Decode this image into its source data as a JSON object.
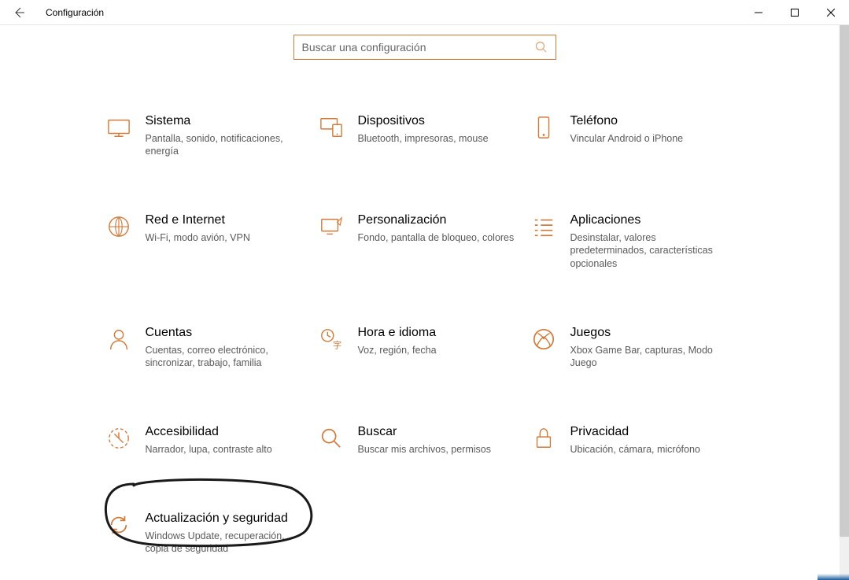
{
  "window": {
    "title": "Configuración"
  },
  "search": {
    "placeholder": "Buscar una configuración"
  },
  "tiles": {
    "system": {
      "title": "Sistema",
      "desc": "Pantalla, sonido, notificaciones, energía"
    },
    "devices": {
      "title": "Dispositivos",
      "desc": "Bluetooth, impresoras, mouse"
    },
    "phone": {
      "title": "Teléfono",
      "desc": "Vincular Android o iPhone"
    },
    "network": {
      "title": "Red e Internet",
      "desc": "Wi-Fi, modo avión, VPN"
    },
    "personalization": {
      "title": "Personalización",
      "desc": "Fondo, pantalla de bloqueo, colores"
    },
    "apps": {
      "title": "Aplicaciones",
      "desc": "Desinstalar, valores predeterminados, características opcionales"
    },
    "accounts": {
      "title": "Cuentas",
      "desc": "Cuentas, correo electrónico, sincronizar, trabajo, familia"
    },
    "time": {
      "title": "Hora e idioma",
      "desc": "Voz, región, fecha"
    },
    "gaming": {
      "title": "Juegos",
      "desc": "Xbox Game Bar, capturas, Modo Juego"
    },
    "ease": {
      "title": "Accesibilidad",
      "desc": "Narrador, lupa, contraste alto"
    },
    "searchcat": {
      "title": "Buscar",
      "desc": "Buscar mis archivos, permisos"
    },
    "privacy": {
      "title": "Privacidad",
      "desc": "Ubicación, cámara, micrófono"
    },
    "update": {
      "title": "Actualización y seguridad",
      "desc": "Windows Update, recuperación, copia de seguridad"
    }
  },
  "colors": {
    "accent": "#d17a3a"
  }
}
